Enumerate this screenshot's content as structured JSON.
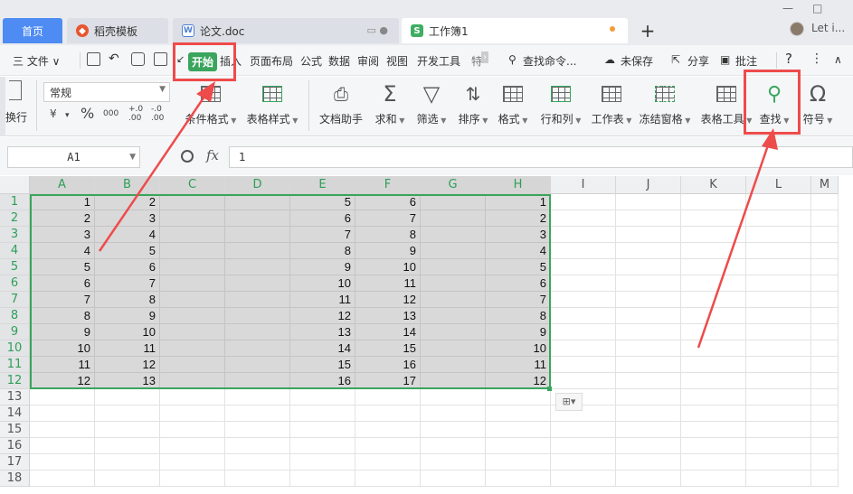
{
  "tabs": {
    "home": "首页",
    "daoke": "稻壳模板",
    "doc": "论文.doc",
    "book": "工作簿1",
    "plus": "+",
    "user": "Let i..."
  },
  "window": {
    "minimize": "—",
    "maximize": "□"
  },
  "menu": {
    "file": "三 文件 ∨",
    "start": "开始",
    "insert": "插入",
    "page_layout": "页面布局",
    "formula": "公式",
    "data": "数据",
    "review": "审阅",
    "view": "视图",
    "dev_tools": "开发工具",
    "more": "特",
    "search": "查找命令...",
    "unsaved": "未保存",
    "share": "分享",
    "comment": "批注",
    "help": "?",
    "kebab": "⋮",
    "collapse": "∧"
  },
  "ribbon": {
    "wrap": "换行",
    "number_format": "常规",
    "currency": "¥",
    "percent": "%",
    "thousands": "000",
    "dec_inc": "+.0 .00",
    "dec_dec": "-.0 .00",
    "cond_format": "条件格式",
    "table_style": "表格样式",
    "doc_helper": "文档助手",
    "sum": "求和",
    "filter": "筛选",
    "sort": "排序",
    "format": "格式",
    "row_col": "行和列",
    "worksheet": "工作表",
    "freeze": "冻结窗格",
    "table_tools": "表格工具",
    "find": "查找",
    "symbol": "符号"
  },
  "formula_bar": {
    "cell_ref": "A1",
    "fx": "fx",
    "value": "1"
  },
  "sheet": {
    "columns": [
      "A",
      "B",
      "C",
      "D",
      "E",
      "F",
      "G",
      "H",
      "I",
      "J",
      "K",
      "L",
      "M"
    ],
    "rows": [
      "1",
      "2",
      "3",
      "4",
      "5",
      "6",
      "7",
      "8",
      "9",
      "10",
      "11",
      "12",
      "13",
      "14",
      "15",
      "16",
      "17",
      "18"
    ],
    "data": [
      [
        "1",
        "2",
        "",
        "",
        "5",
        "6",
        "",
        "1"
      ],
      [
        "2",
        "3",
        "",
        "",
        "6",
        "7",
        "",
        "2"
      ],
      [
        "3",
        "4",
        "",
        "",
        "7",
        "8",
        "",
        "3"
      ],
      [
        "4",
        "5",
        "",
        "",
        "8",
        "9",
        "",
        "4"
      ],
      [
        "5",
        "6",
        "",
        "",
        "9",
        "10",
        "",
        "5"
      ],
      [
        "6",
        "7",
        "",
        "",
        "10",
        "11",
        "",
        "6"
      ],
      [
        "7",
        "8",
        "",
        "",
        "11",
        "12",
        "",
        "7"
      ],
      [
        "8",
        "9",
        "",
        "",
        "12",
        "13",
        "",
        "8"
      ],
      [
        "9",
        "10",
        "",
        "",
        "13",
        "14",
        "",
        "9"
      ],
      [
        "10",
        "11",
        "",
        "",
        "14",
        "15",
        "",
        "10"
      ],
      [
        "11",
        "12",
        "",
        "",
        "15",
        "16",
        "",
        "11"
      ],
      [
        "12",
        "13",
        "",
        "",
        "16",
        "17",
        "",
        "12"
      ]
    ]
  },
  "colors": {
    "accent": "#3aa55d",
    "highlight": "#ee4b4b",
    "home_tab": "#4e8bf3"
  }
}
